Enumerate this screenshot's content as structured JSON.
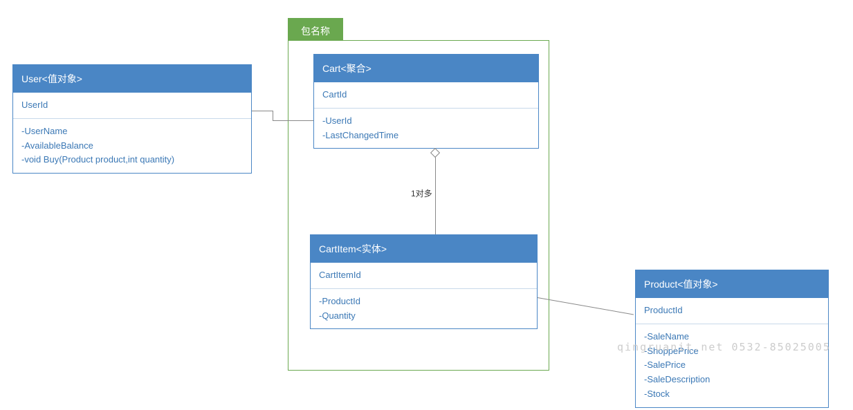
{
  "package": {
    "label": "包名称"
  },
  "entities": {
    "user": {
      "title": "User<值对象>",
      "id_row": "UserId",
      "attrs": [
        "-UserName",
        "-AvailableBalance",
        "-void Buy(Product product,int quantity)"
      ]
    },
    "cart": {
      "title": "Cart<聚合>",
      "id_row": "CartId",
      "attrs": [
        "-UserId",
        "-LastChangedTime"
      ]
    },
    "cartitem": {
      "title": "CartItem<实体>",
      "id_row": "CartItemId",
      "attrs": [
        "-ProductId",
        "-Quantity"
      ]
    },
    "product": {
      "title": "Product<值对象>",
      "id_row": "ProductId",
      "attrs": [
        "-SaleName",
        "-ShoppePrice",
        "-SalePrice",
        "-SaleDescription",
        "-Stock"
      ]
    }
  },
  "connectors": {
    "cart_cartitem_label": "1对多"
  },
  "watermark": "qingruanit.net 0532-85025005"
}
